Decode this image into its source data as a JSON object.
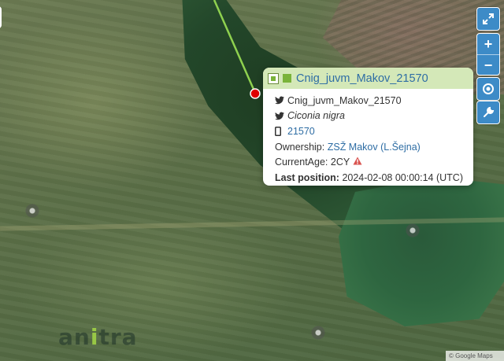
{
  "map": {
    "track_color": "#8fd14f",
    "marker_color": "#e00000"
  },
  "controls": {
    "fullscreen_icon": "expand-arrows-icon",
    "zoom_in_label": "+",
    "zoom_out_label": "−",
    "locate_icon": "target-icon",
    "tools_icon": "wrench-icon",
    "accent_color": "#3d8bc7"
  },
  "popup": {
    "title": "Cnig_juvm_Makov_21570",
    "series_color": "#7ab33a",
    "header_bg": "#d4e8b8",
    "name": "Cnig_juvm_Makov_21570",
    "species": "Ciconia nigra",
    "device_id": "21570",
    "ownership_label": "Ownership:",
    "ownership_value": "ZSŽ Makov (L.Šejna)",
    "current_age_label": "CurrentAge:",
    "current_age_value": "2CY",
    "last_position_label": "Last position:",
    "last_position_value": "2024-02-08 00:00:14 (UTC)"
  },
  "logo": {
    "text_a": "an",
    "text_i": "i",
    "text_rest": "tra"
  },
  "attribution": {
    "text": "© Google Maps"
  }
}
